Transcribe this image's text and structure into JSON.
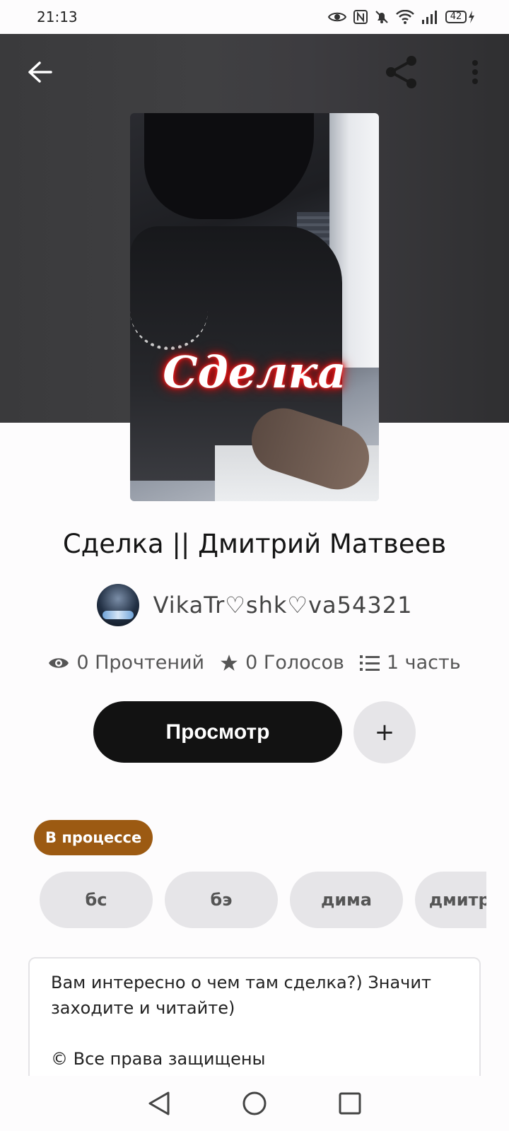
{
  "status_bar": {
    "time": "21:13",
    "battery": "42",
    "icons": [
      "eye-icon",
      "nfc-icon",
      "bell-off-icon",
      "wifi-icon",
      "signal-icon",
      "battery-icon",
      "charging-icon"
    ]
  },
  "toolbar": {
    "back_icon": "arrow-left-icon",
    "share_icon": "share-icon",
    "more_icon": "more-vertical-icon"
  },
  "cover": {
    "title_text": "Сделка"
  },
  "book": {
    "title": "Сделка || Дмитрий Матвеев",
    "author": "VikaTr♡shk♡va54321"
  },
  "stats": {
    "reads": "0 Прочтений",
    "votes": "0 Голосов",
    "parts": "1 часть"
  },
  "actions": {
    "read_label": "Просмотр",
    "add_label": "+"
  },
  "status_badge": "В процессе",
  "tags": [
    "бс",
    "бэ",
    "дима",
    "дмитрий"
  ],
  "description": {
    "text": "Вам интересно о чем там сделка?) Значит заходите и читайте)",
    "copyright": "© Все права защищены"
  },
  "colors": {
    "accent_button": "#121212",
    "badge": "#9c5a12",
    "chip": "#e6e5e8"
  }
}
